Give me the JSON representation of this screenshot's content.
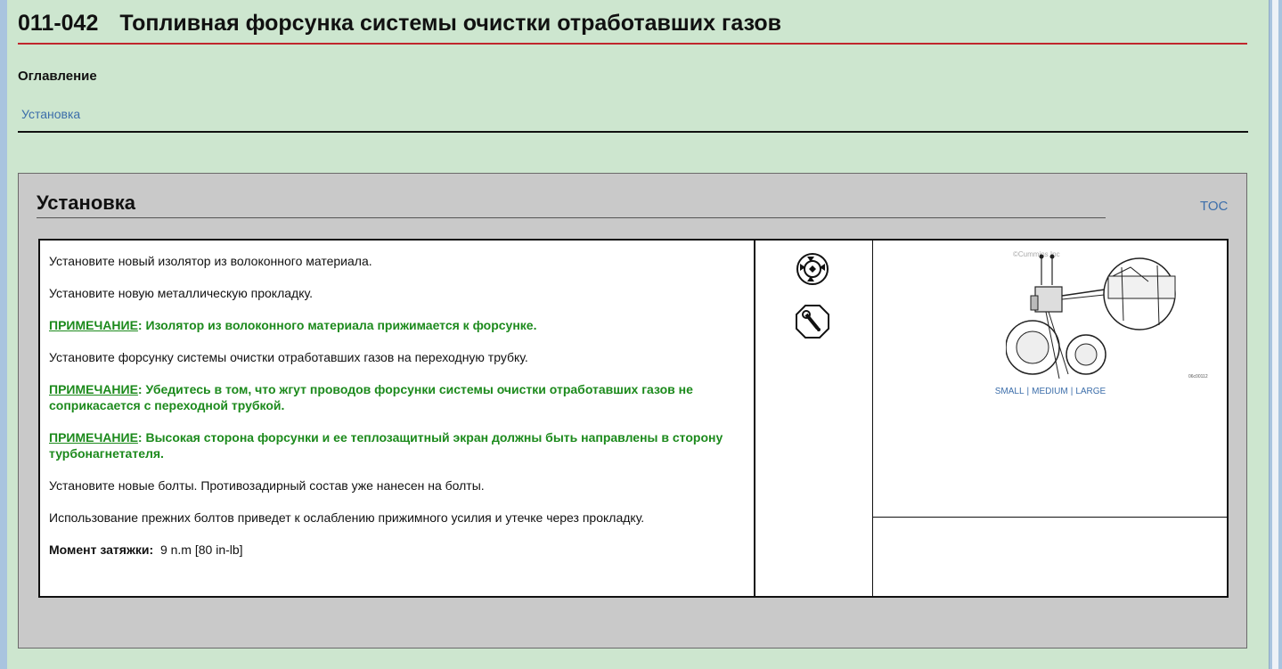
{
  "header": {
    "number": "011-042",
    "title": "Топливная форсунка системы очистки отработавших газов"
  },
  "toc": {
    "heading": "Оглавление",
    "links": [
      "Установка"
    ]
  },
  "section": {
    "title": "Установка",
    "toc_link": "TOC",
    "steps": [
      "Установите новый изолятор из волоконного материала.",
      "Установите новую металлическую прокладку."
    ],
    "note1": {
      "label": "ПРИМЕЧАНИЕ",
      "text": ": Изолятор из волоконного материала прижимается к форсунке."
    },
    "step3": "Установите форсунку системы очистки отработавших газов на переходную трубку.",
    "note2": {
      "label": "ПРИМЕЧАНИЕ",
      "text": ": Убедитесь в том, что жгут проводов форсунки системы очистки отработавших газов не соприкасается с переходной трубкой."
    },
    "note3": {
      "label": "ПРИМЕЧАНИЕ",
      "text": ": Высокая сторона форсунки и ее теплозащитный экран должны быть направлены в сторону турбонагнетателя."
    },
    "step4": "Установите новые болты. Противозадирный состав уже нанесен на болты.",
    "step5": "Использование прежних болтов приведет к ослаблению прижимного усилия и утечке через прокладку.",
    "torque": {
      "label": "Момент затяжки:",
      "value": "9  n.m  [80 in-lb]"
    },
    "icons": [
      "socket-wrench-icon",
      "torque-wrench-icon"
    ],
    "figure": {
      "watermark": "©Cummins Inc",
      "code": "06c00112",
      "size_links": [
        "SMALL",
        "MEDIUM",
        "LARGE"
      ]
    }
  }
}
